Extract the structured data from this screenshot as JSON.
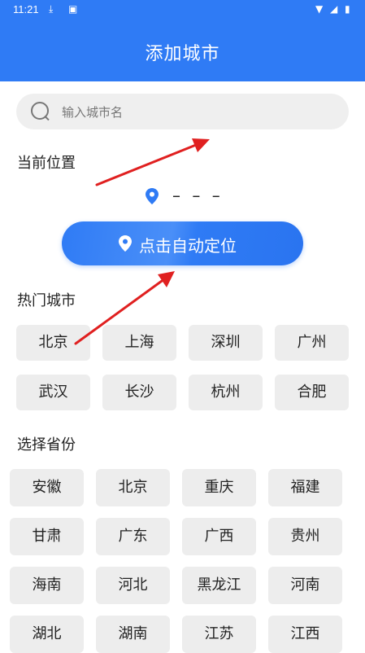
{
  "status_bar": {
    "time": "11:21"
  },
  "header": {
    "title": "添加城市"
  },
  "search": {
    "placeholder": "输入城市名"
  },
  "current_location": {
    "label": "当前位置",
    "value": "– – –"
  },
  "locate_button": {
    "label": "点击自动定位"
  },
  "hot_cities": {
    "label": "热门城市",
    "items": [
      "北京",
      "上海",
      "深圳",
      "广州",
      "武汉",
      "长沙",
      "杭州",
      "合肥"
    ]
  },
  "provinces": {
    "label": "选择省份",
    "items": [
      "安徽",
      "北京",
      "重庆",
      "福建",
      "甘肃",
      "广东",
      "广西",
      "贵州",
      "海南",
      "河北",
      "黑龙江",
      "河南",
      "湖北",
      "湖南",
      "江苏",
      "江西"
    ]
  },
  "colors": {
    "accent": "#2f7bf5",
    "chip_bg": "#ededed",
    "annotation_arrow": "#e02020"
  }
}
